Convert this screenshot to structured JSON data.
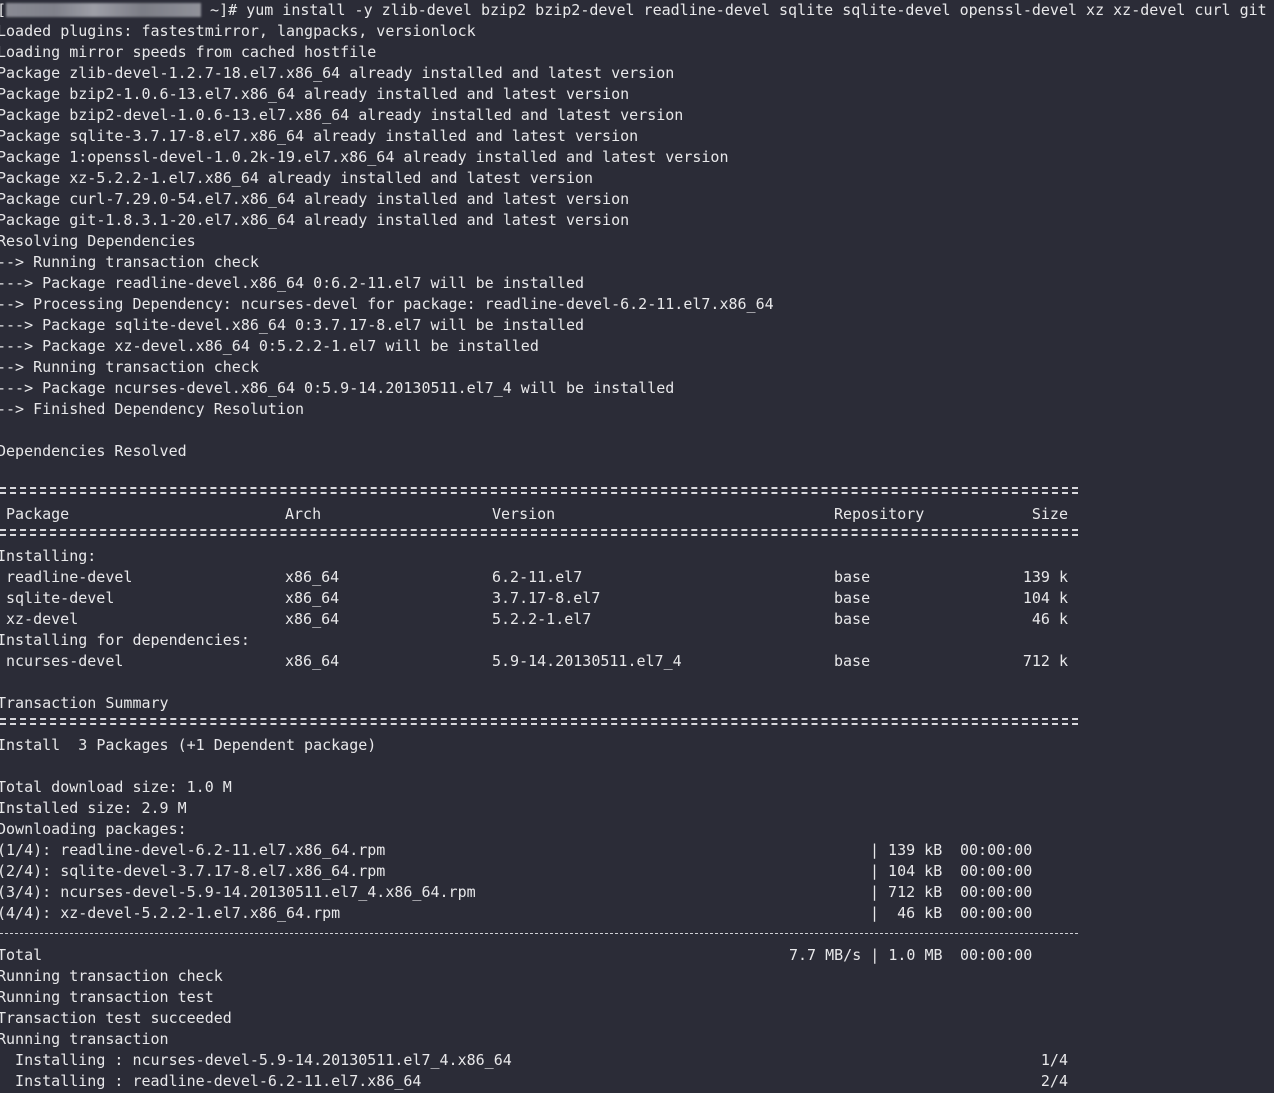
{
  "prompt": {
    "open_bracket": "[",
    "suffix": " ~]# ",
    "command": "yum install -y zlib-devel bzip2 bzip2-devel readline-devel sqlite sqlite-devel openssl-devel xz xz-devel curl git"
  },
  "log_lines": [
    "Loaded plugins: fastestmirror, langpacks, versionlock",
    "Loading mirror speeds from cached hostfile",
    "Package zlib-devel-1.2.7-18.el7.x86_64 already installed and latest version",
    "Package bzip2-1.0.6-13.el7.x86_64 already installed and latest version",
    "Package bzip2-devel-1.0.6-13.el7.x86_64 already installed and latest version",
    "Package sqlite-3.7.17-8.el7.x86_64 already installed and latest version",
    "Package 1:openssl-devel-1.0.2k-19.el7.x86_64 already installed and latest version",
    "Package xz-5.2.2-1.el7.x86_64 already installed and latest version",
    "Package curl-7.29.0-54.el7.x86_64 already installed and latest version",
    "Package git-1.8.3.1-20.el7.x86_64 already installed and latest version",
    "Resolving Dependencies",
    "--> Running transaction check",
    "---> Package readline-devel.x86_64 0:6.2-11.el7 will be installed",
    "--> Processing Dependency: ncurses-devel for package: readline-devel-6.2-11.el7.x86_64",
    "---> Package sqlite-devel.x86_64 0:3.7.17-8.el7 will be installed",
    "---> Package xz-devel.x86_64 0:5.2.2-1.el7 will be installed",
    "--> Running transaction check",
    "---> Package ncurses-devel.x86_64 0:5.9-14.20130511.el7_4 will be installed",
    "--> Finished Dependency Resolution",
    "",
    "Dependencies Resolved"
  ],
  "table": {
    "headers": {
      "package": "Package",
      "arch": "Arch",
      "version": "Version",
      "repository": "Repository",
      "size": "Size"
    },
    "installing_label": "Installing:",
    "installing": [
      {
        "package": "readline-devel",
        "arch": "x86_64",
        "version": "6.2-11.el7",
        "repository": "base",
        "size": "139 k"
      },
      {
        "package": "sqlite-devel",
        "arch": "x86_64",
        "version": "3.7.17-8.el7",
        "repository": "base",
        "size": "104 k"
      },
      {
        "package": "xz-devel",
        "arch": "x86_64",
        "version": "5.2.2-1.el7",
        "repository": "base",
        "size": "46 k"
      }
    ],
    "deps_label": "Installing for dependencies:",
    "deps": [
      {
        "package": "ncurses-devel",
        "arch": "x86_64",
        "version": "5.9-14.20130511.el7_4",
        "repository": "base",
        "size": "712 k"
      }
    ]
  },
  "summary": {
    "title": "Transaction Summary",
    "install_line": "Install  3 Packages (+1 Dependent package)",
    "total_download": "Total download size: 1.0 M",
    "installed_size": "Installed size: 2.9 M",
    "downloading": "Downloading packages:"
  },
  "downloads": [
    {
      "name": "(1/4): readline-devel-6.2-11.el7.x86_64.rpm",
      "size": "| 139 kB",
      "time": "00:00:00"
    },
    {
      "name": "(2/4): sqlite-devel-3.7.17-8.el7.x86_64.rpm",
      "size": "| 104 kB",
      "time": "00:00:00"
    },
    {
      "name": "(3/4): ncurses-devel-5.9-14.20130511.el7_4.x86_64.rpm",
      "size": "| 712 kB",
      "time": "00:00:00"
    },
    {
      "name": "(4/4): xz-devel-5.2.2-1.el7.x86_64.rpm",
      "size": "|  46 kB",
      "time": "00:00:00"
    }
  ],
  "total": {
    "label": "Total",
    "rate": "7.7 MB/s | 1.0 MB",
    "time": "00:00:00"
  },
  "final_lines": [
    "Running transaction check",
    "Running transaction test",
    "Transaction test succeeded",
    "Running transaction"
  ],
  "progress": [
    {
      "text": "  Installing : ncurses-devel-5.9-14.20130511.el7_4.x86_64",
      "count": "1/4"
    },
    {
      "text": "  Installing : readline-devel-6.2-11.el7.x86_64",
      "count": "2/4"
    }
  ]
}
